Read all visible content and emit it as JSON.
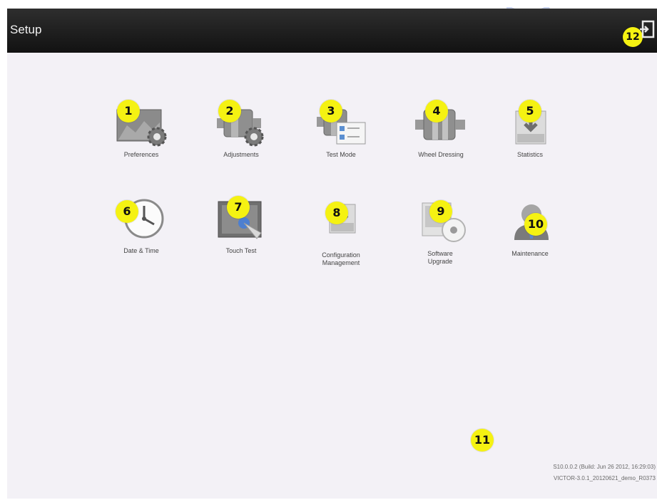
{
  "window": {
    "title": "Setup"
  },
  "header": {
    "exit_icon": "exit-door-icon",
    "exit_badge": "12"
  },
  "tiles": [
    {
      "badge": "1",
      "label": "Preferences",
      "icon": "preferences-gear-icon"
    },
    {
      "badge": "2",
      "label": "Adjustments",
      "icon": "adjustments-gear-icon"
    },
    {
      "badge": "3",
      "label": "Test Mode",
      "icon": "test-mode-checklist-icon"
    },
    {
      "badge": "4",
      "label": "Wheel Dressing",
      "icon": "wheel-dressing-icon"
    },
    {
      "badge": "5",
      "label": "Statistics",
      "icon": "statistics-download-icon"
    },
    {
      "badge": "6",
      "label": "Date & Time",
      "icon": "clock-icon"
    },
    {
      "badge": "7",
      "label": "Touch Test",
      "icon": "touch-hand-icon"
    },
    {
      "badge": "8",
      "label": "Configuration Management",
      "icon": "configuration-download-icon"
    },
    {
      "badge": "9",
      "label": "Software Upgrade",
      "icon": "software-disc-icon"
    },
    {
      "badge": "10",
      "label": "Maintenance",
      "icon": "technician-icon"
    }
  ],
  "footer": {
    "badge": "11",
    "version_line1": "S10.0.0.2 (Build: Jun 26 2012, 16:29:03)",
    "version_line2": "VICTOR-3.0.1_20120621_demo_R0373"
  },
  "colors": {
    "titlebar": "#1c1c1c",
    "background": "#f3f1f6",
    "badge": "#f5f212"
  }
}
